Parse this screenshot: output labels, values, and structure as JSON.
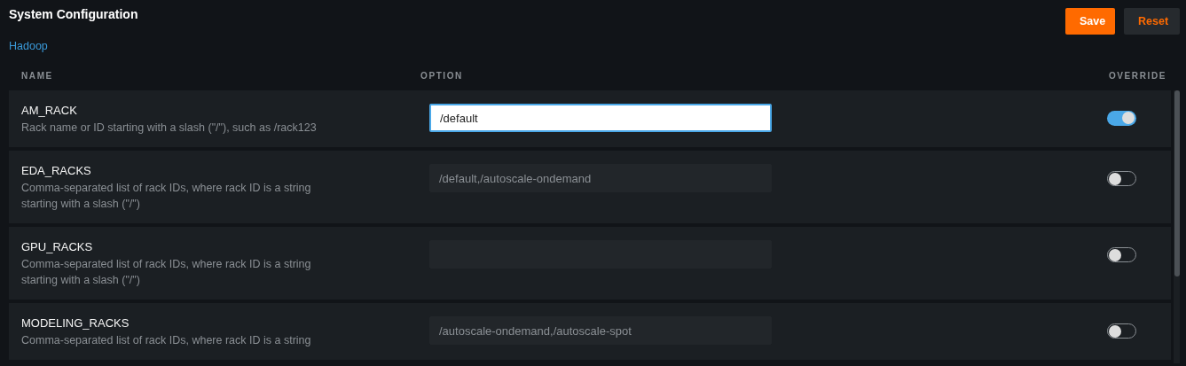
{
  "title": "System Configuration",
  "buttons": [
    {
      "label": "Save",
      "kind": "primary"
    },
    {
      "label": "Reset",
      "kind": "secondary"
    }
  ],
  "breadcrumb": "Hadoop",
  "columns": [
    "NAME",
    "OPTION",
    "OVERRIDE"
  ],
  "rows": [
    {
      "name": "AM_RACK",
      "description": "Rack name or ID starting with a slash (\"/\"), such as /rack123",
      "value": "/default",
      "focused": true,
      "override": true
    },
    {
      "name": "EDA_RACKS",
      "description": "Comma-separated list of rack IDs, where rack ID is a string starting with a slash (\"/\")",
      "value": "/default,/autoscale-ondemand",
      "focused": false,
      "override": false
    },
    {
      "name": "GPU_RACKS",
      "description": "Comma-separated list of rack IDs, where rack ID is a string starting with a slash (\"/\")",
      "focused": false,
      "override": false
    },
    {
      "name": "MODELING_RACKS",
      "description": "Comma-separated list of rack IDs, where rack ID is a string",
      "value": "/autoscale-ondemand,/autoscale-spot",
      "focused": false,
      "override": false
    }
  ]
}
